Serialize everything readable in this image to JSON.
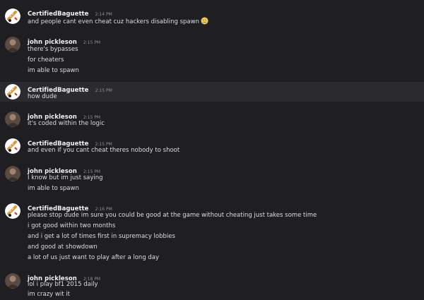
{
  "messages": [
    {
      "author": "CertifiedBaguette",
      "avatar": "baguette-avatar",
      "time": "2:14 PM",
      "lines": [
        "and people cant even cheat cuz hackers disabling spawn"
      ],
      "emoji": "crying-face-emoji"
    },
    {
      "author": "john pickleson",
      "avatar": "pickleson-avatar",
      "time": "2:15 PM",
      "lines": [
        "there's bypasses",
        "for cheaters",
        "im able to spawn"
      ]
    },
    {
      "author": "CertifiedBaguette",
      "avatar": "baguette-avatar",
      "time": "2:15 PM",
      "lines": [
        "how dude"
      ]
    },
    {
      "author": "john pickleson",
      "avatar": "pickleson-avatar",
      "time": "2:15 PM",
      "lines": [
        "it's coded within the logic"
      ]
    },
    {
      "author": "CertifiedBaguette",
      "avatar": "baguette-avatar",
      "time": "2:15 PM",
      "lines": [
        "and even if you cant cheat theres nobody to shoot"
      ]
    },
    {
      "author": "john pickleson",
      "avatar": "pickleson-avatar",
      "time": "2:15 PM",
      "lines": [
        "I know but im just saying",
        "im able to spawn"
      ]
    },
    {
      "author": "CertifiedBaguette",
      "avatar": "baguette-avatar",
      "time": "2:16 PM",
      "lines": [
        "please stop dude im sure you could be good at the game without cheating just takes some time",
        "i got good within two months",
        "and i get a lot of times first in supremacy lobbies",
        "and good at showdown",
        "a lot of us just want to play after a long day"
      ]
    },
    {
      "author": "john pickleson",
      "avatar": "pickleson-avatar",
      "time": "2:18 PM",
      "lines": [
        "lol i play bf1 2015 daily",
        "im crazy wit it"
      ]
    }
  ],
  "colors": {
    "background": "#1f1f23",
    "highlight": "#2a2a2f",
    "username": "#f2f3f5",
    "timestamp": "#8e9297",
    "text": "#dcdde0"
  }
}
